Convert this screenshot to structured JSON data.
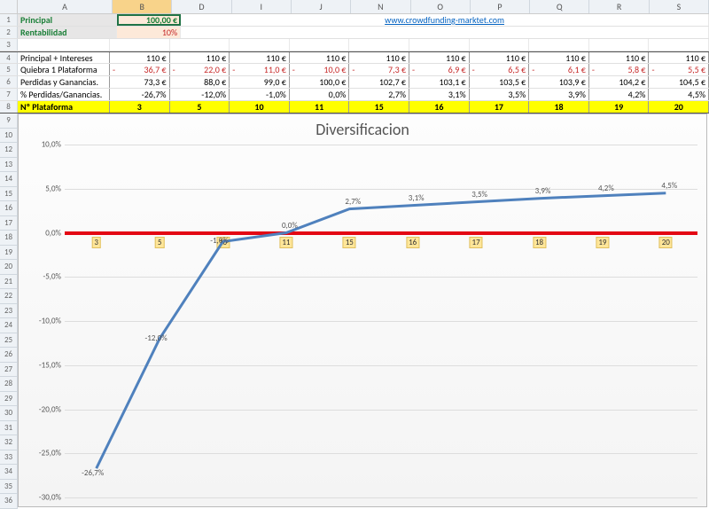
{
  "columns": [
    "A",
    "B",
    "D",
    "I",
    "J",
    "N",
    "O",
    "P",
    "Q",
    "R",
    "S"
  ],
  "active_col": "B",
  "header": {
    "principal_label": "Principal",
    "principal_value": "100,00 €",
    "rentabilidad_label": "Rentabilidad",
    "rentabilidad_value": "10%",
    "link_text": "www.crowdfunding-marktet.com"
  },
  "rows": {
    "r4": {
      "label": "Principal + Intereses",
      "vals": [
        "110 €",
        "110 €",
        "110 €",
        "110 €",
        "110 €",
        "110 €",
        "110 €",
        "110 €",
        "110 €",
        "110 €"
      ]
    },
    "r5": {
      "label": "Quiebra 1 Plataforma",
      "vals": [
        "36,7 €",
        "22,0 €",
        "11,0 €",
        "10,0 €",
        "7,3 €",
        "6,9 €",
        "6,5 €",
        "6,1 €",
        "5,8 €",
        "5,5 €"
      ]
    },
    "r6": {
      "label": "Perdidas y Ganancias.",
      "vals": [
        "73,3 €",
        "88,0 €",
        "99,0 €",
        "100,0 €",
        "102,7 €",
        "103,1 €",
        "103,5 €",
        "103,9 €",
        "104,2 €",
        "104,5 €"
      ]
    },
    "r7": {
      "label": "% Perdidas/Ganancias.",
      "vals": [
        "-26,7%",
        "-12,0%",
        "-1,0%",
        "0,0%",
        "2,7%",
        "3,1%",
        "3,5%",
        "3,9%",
        "4,2%",
        "4,5%"
      ]
    },
    "r8": {
      "label": "Nº Plataforma",
      "vals": [
        "3",
        "5",
        "10",
        "11",
        "15",
        "16",
        "17",
        "18",
        "19",
        "20"
      ]
    }
  },
  "chart_data": {
    "type": "line",
    "title": "Diversificacion",
    "categories": [
      "3",
      "5",
      "10",
      "11",
      "15",
      "16",
      "17",
      "18",
      "19",
      "20"
    ],
    "values": [
      -26.7,
      -12.0,
      -1.0,
      0.0,
      2.7,
      3.1,
      3.5,
      3.9,
      4.2,
      4.5
    ],
    "labels": [
      "-26,7%",
      "-12,0%",
      "-1,0%",
      "0,0%",
      "2,7%",
      "3,1%",
      "3,5%",
      "3,9%",
      "4,2%",
      "4,5%"
    ],
    "ylabel": "",
    "xlabel": "",
    "ylim": [
      -30,
      10
    ],
    "yticks": [
      -30,
      -25,
      -20,
      -15,
      -10,
      -5,
      0,
      5,
      10
    ],
    "ytick_labels": [
      "-30,0%",
      "-25,0%",
      "-20,0%",
      "-15,0%",
      "-10,0%",
      "-5,0%",
      "0,0%",
      "5,0%",
      "10,0%"
    ],
    "ref_line": 0
  },
  "row_numbers_visible": [
    "1",
    "2",
    "3",
    "4",
    "5",
    "6",
    "7",
    "8",
    "9",
    "10",
    "12",
    "13",
    "14",
    "15",
    "16",
    "17",
    "18",
    "19",
    "20",
    "21",
    "22",
    "23",
    "24",
    "25",
    "26",
    "27",
    "28",
    "29",
    "30",
    "31",
    "32",
    "33",
    "34",
    "35",
    "36"
  ]
}
